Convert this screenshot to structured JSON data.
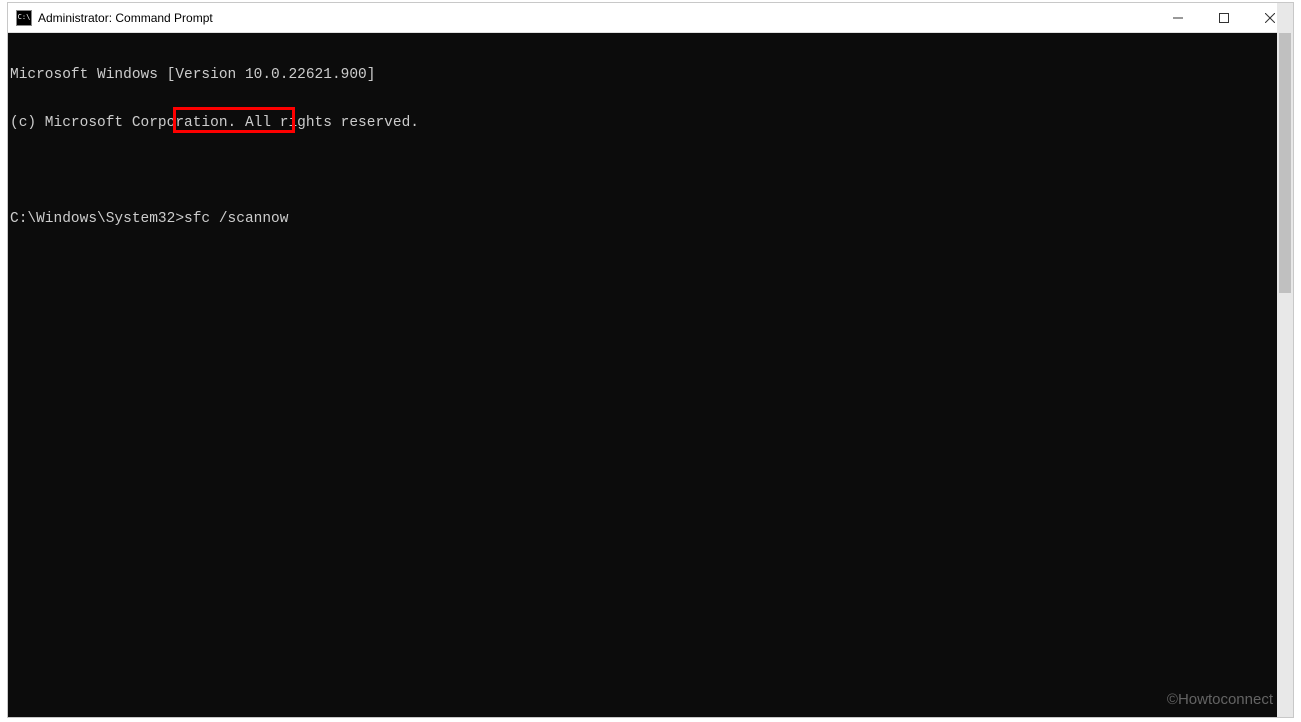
{
  "titlebar": {
    "icon_label": "C:\\",
    "title": "Administrator: Command Prompt"
  },
  "terminal": {
    "header_line1": "Microsoft Windows [Version 10.0.22621.900]",
    "header_line2": "(c) Microsoft Corporation. All rights reserved.",
    "prompt": "C:\\Windows\\System32>",
    "command": "sfc /scannow"
  },
  "watermark": "©Howtoconnect"
}
